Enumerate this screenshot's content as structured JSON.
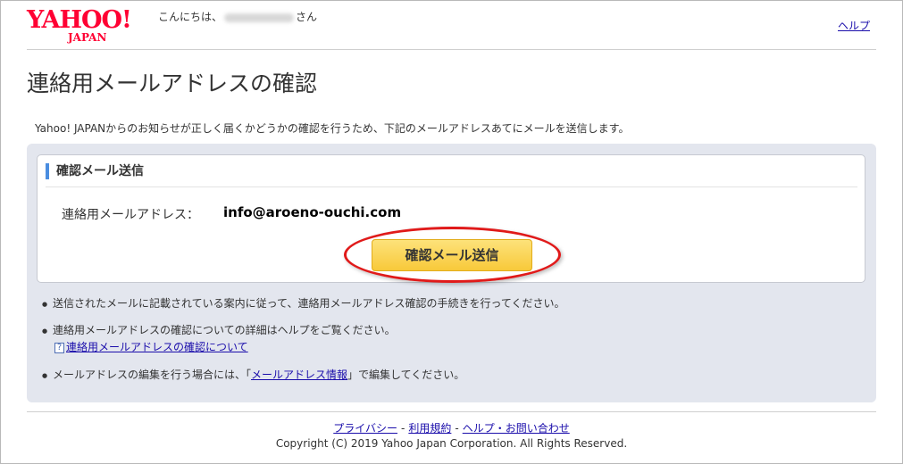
{
  "header": {
    "logo_word": "YAHOO!",
    "logo_sub": "JAPAN",
    "greeting_prefix": "こんにちは、",
    "greeting_suffix": "さん",
    "help_link": "ヘルプ"
  },
  "page_title": "連絡用メールアドレスの確認",
  "intro": "Yahoo! JAPANからのお知らせが正しく届くかどうかの確認を行うため、下記のメールアドレスあてにメールを送信します。",
  "card": {
    "heading": "確認メール送信",
    "email_label": "連絡用メールアドレス：",
    "email_value": "info@aroeno-ouchi.com",
    "send_button": "確認メール送信"
  },
  "notes": {
    "bullet": "●",
    "note1": "送信されたメールに記載されている案内に従って、連絡用メールアドレス確認の手続きを行ってください。",
    "note2": "連絡用メールアドレスの確認についての詳細はヘルプをご覧ください。",
    "help_icon": "?",
    "note2_link": "連絡用メールアドレスの確認について",
    "note3_prefix": "メールアドレスの編集を行う場合には、「",
    "note3_link": "メールアドレス情報",
    "note3_suffix": "」で編集してください。"
  },
  "footer": {
    "links": [
      "プライバシー",
      "利用規約",
      "ヘルプ・お問い合わせ"
    ],
    "separator": "-",
    "copyright": "Copyright (C) 2019 Yahoo Japan Corporation. All Rights Reserved."
  },
  "colors": {
    "brand": "#ff0033",
    "link": "#1a0dab",
    "accent_bar": "#4a8de0",
    "button": "#f8c93a",
    "panel": "#e3e6ee",
    "highlight": "#e01a1a"
  }
}
